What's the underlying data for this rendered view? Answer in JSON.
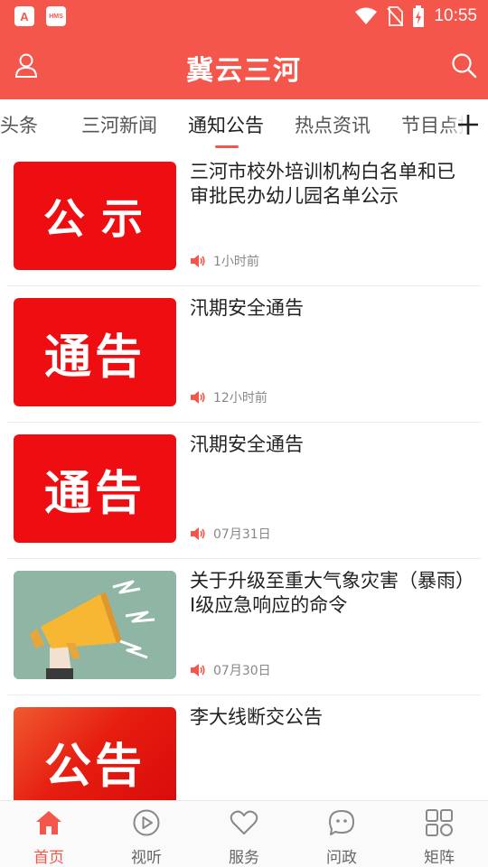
{
  "status_bar": {
    "app_icon_a": "A",
    "app_icon_hms": "HMS",
    "time": "10:55"
  },
  "header": {
    "title": "冀云三河",
    "left_icon": "user-icon",
    "right_icon": "search-icon"
  },
  "tabs": [
    {
      "label": "冀云头条",
      "active": false
    },
    {
      "label": "三河新闻",
      "active": false
    },
    {
      "label": "通知公告",
      "active": true
    },
    {
      "label": "热点资讯",
      "active": false
    },
    {
      "label": "节目点播",
      "active": false
    }
  ],
  "tab_add_icon": "plus-icon",
  "news": [
    {
      "title": "三河市校外培训机构白名单和已审批民办幼儿园名单公示",
      "time": "1小时前",
      "thumb_text": "公示",
      "thumb": "red-banner"
    },
    {
      "title": "汛期安全通告",
      "time": "12小时前",
      "thumb_text": "通告",
      "thumb": "red-banner"
    },
    {
      "title": "汛期安全通告",
      "time": "07月31日",
      "thumb_text": "通告",
      "thumb": "red-banner"
    },
    {
      "title": "关于升级至重大气象灾害（暴雨）Ⅰ级应急响应的命令",
      "time": "07月30日",
      "thumb_text": "",
      "thumb": "megaphone-illustration"
    },
    {
      "title": "李大线断交公告",
      "time": "",
      "thumb_text": "公告",
      "thumb": "red-banner"
    }
  ],
  "meta_icon": "speaker-icon",
  "bottom_nav": [
    {
      "label": "首页",
      "icon": "home-icon",
      "active": true
    },
    {
      "label": "视听",
      "icon": "play-icon",
      "active": false
    },
    {
      "label": "服务",
      "icon": "heart-icon",
      "active": false
    },
    {
      "label": "问政",
      "icon": "chat-bubble-icon",
      "active": false
    },
    {
      "label": "矩阵",
      "icon": "grid-icon",
      "active": false
    }
  ],
  "colors": {
    "accent": "#f4564b",
    "banner_red": "#ee0d10",
    "text": "#222222",
    "muted": "#888888"
  }
}
